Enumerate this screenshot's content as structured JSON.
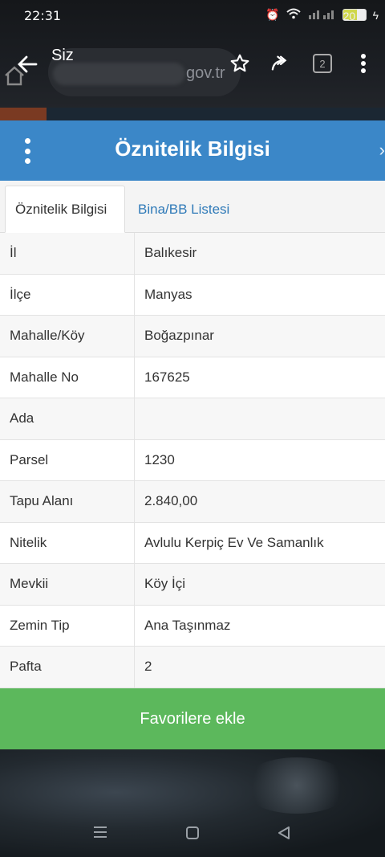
{
  "status_bar": {
    "time": "22:31",
    "battery": "20"
  },
  "browser": {
    "profile_label": "Siz",
    "url_domain": "gov.tr",
    "tab_count": "2"
  },
  "panel": {
    "title": "Öznitelik Bilgisi",
    "accent_color": "#3b87c8"
  },
  "tabs": [
    {
      "label": "Öznitelik Bilgisi",
      "active": true
    },
    {
      "label": "Bina/BB Listesi",
      "active": false
    }
  ],
  "attributes": [
    {
      "key": "İl",
      "value": "Balıkesir"
    },
    {
      "key": "İlçe",
      "value": "Manyas"
    },
    {
      "key": "Mahalle/Köy",
      "value": "Boğazpınar"
    },
    {
      "key": "Mahalle No",
      "value": "167625"
    },
    {
      "key": "Ada",
      "value": ""
    },
    {
      "key": "Parsel",
      "value": "1230"
    },
    {
      "key": "Tapu Alanı",
      "value": "2.840,00"
    },
    {
      "key": "Nitelik",
      "value": "Avlulu Kerpiç Ev Ve Samanlık"
    },
    {
      "key": "Mevkii",
      "value": "Köy İçi"
    },
    {
      "key": "Zemin Tip",
      "value": "Ana Taşınmaz"
    },
    {
      "key": "Pafta",
      "value": "2"
    }
  ],
  "favorite_button": {
    "label": "Favorilere ekle",
    "color": "#5cb85c"
  },
  "icons": {
    "back": "back-arrow-icon",
    "bookmark": "star-icon",
    "share": "share-icon",
    "menu": "more-vert-icon"
  }
}
